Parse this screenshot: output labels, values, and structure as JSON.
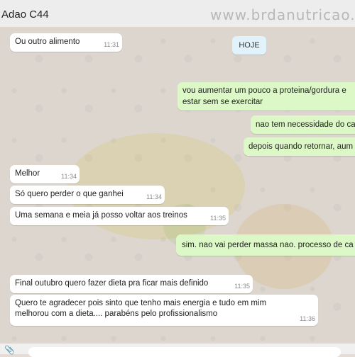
{
  "header": {
    "contact_name": "Adao C44",
    "watermark": "www.brdanutricao.co"
  },
  "day_badge": "HOJE",
  "messages": [
    {
      "dir": "in",
      "text": "Ou outro alimento",
      "time": "11:31"
    },
    {
      "dir": "out",
      "lines": [
        "vou aumentar um pouco a proteina/gordura e",
        "estar sem se exercitar"
      ]
    },
    {
      "dir": "out",
      "text": "nao tem necessidade do ca"
    },
    {
      "dir": "out",
      "text": "depois quando retornar, aum"
    },
    {
      "dir": "in",
      "text": "Melhor",
      "time": "11:34"
    },
    {
      "dir": "in",
      "text": "Só quero perder o que ganhei",
      "time": "11:34"
    },
    {
      "dir": "in",
      "text": "Uma semana e meia já posso voltar aos treinos",
      "time": "11:35"
    },
    {
      "dir": "out",
      "text": "sim. nao vai perder massa nao. processo de ca"
    },
    {
      "dir": "in",
      "text": "Final outubro quero fazer dieta pra ficar mais definido",
      "time": "11:35"
    },
    {
      "dir": "in",
      "lines": [
        "Quero te agradecer pois sinto que tenho mais energia e tudo em mim",
        "melhorou com a dieta.... parabéns pelo profissionalismo"
      ],
      "time": "11:36"
    }
  ],
  "colors": {
    "incoming_bubble": "#ffffff",
    "outgoing_bubble": "#dcf8c6",
    "header_bg": "#ededed",
    "day_badge_bg": "#e1f2fb"
  },
  "icons": {
    "attach": "paperclip-icon"
  }
}
